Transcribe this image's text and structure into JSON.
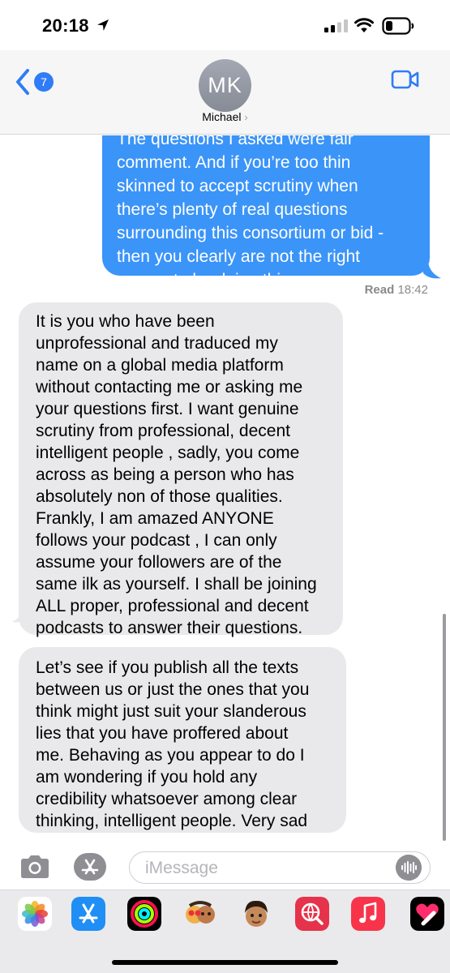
{
  "status_bar": {
    "time": "20:18",
    "icons": [
      "location-arrow-icon",
      "signal-icon",
      "wifi-icon",
      "battery-icon"
    ]
  },
  "header": {
    "back_badge": "7",
    "avatar_initials": "MK",
    "contact_name": "Michael",
    "contact_chevron": "›",
    "icons": [
      "back-chevron-icon",
      "video-call-icon"
    ],
    "accent_color": "#2f7cf6"
  },
  "thread": {
    "sent_message": {
      "lines": [
        "The questions I asked were fair",
        "comment. And if you’re too thin",
        "skinned to accept scrutiny when",
        "there’s plenty of real questions",
        "surrounding this consortium or bid -",
        "then you clearly are not the right",
        "person to be doing this."
      ],
      "bubble_color": "#3b94f8"
    },
    "read_receipt": {
      "label": "Read",
      "time": "18:42"
    },
    "received_messages": [
      {
        "lines": [
          "It is you who have been",
          "unprofessional and traduced my",
          "name on a global media platform",
          "without contacting me or asking me",
          "your questions first. I want genuine",
          "scrutiny from professional, decent",
          "intelligent people , sadly, you come",
          "across as being a person who has",
          "absolutely non of those qualities.",
          "Frankly, I am amazed ANYONE",
          "follows your podcast , I can only",
          "assume your followers are of the",
          "same ilk as yourself. I shall be joining",
          "ALL proper, professional and decent",
          "podcasts to answer their questions."
        ]
      },
      {
        "lines": [
          "Let’s see if you publish all the texts",
          "between us or just the ones that  you",
          "think might just suit your slanderous",
          "lies that you have proffered about",
          "me. Behaving as you appear to do I",
          "am wondering if you hold any",
          "credibility whatsoever among clear",
          "thinking, intelligent people. Very sad"
        ]
      }
    ],
    "received_bubble_color": "#e9e9eb"
  },
  "input_bar": {
    "placeholder": "iMessage",
    "icons": [
      "camera-icon",
      "app-store-icon",
      "audio-waveform-icon"
    ]
  },
  "app_drawer": {
    "apps": [
      {
        "name": "photos-app-icon"
      },
      {
        "name": "app-store-app-icon"
      },
      {
        "name": "activity-app-icon"
      },
      {
        "name": "memoji-stickers-icon"
      },
      {
        "name": "animoji-icon"
      },
      {
        "name": "web-images-search-icon"
      },
      {
        "name": "music-app-icon"
      },
      {
        "name": "digital-touch-icon"
      }
    ]
  }
}
